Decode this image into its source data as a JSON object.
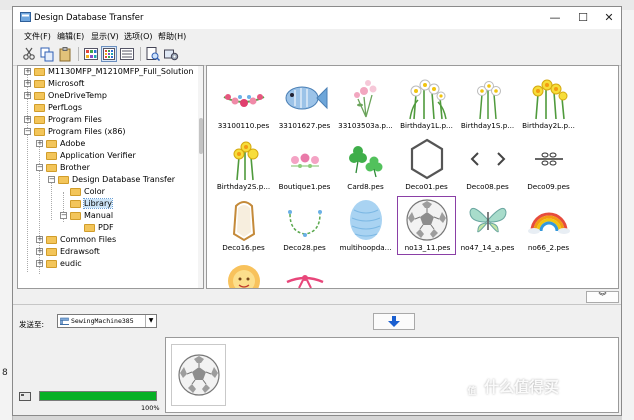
{
  "window": {
    "title": "Design Database Transfer"
  },
  "window_controls": {
    "minimize": "—",
    "maximize": "☐",
    "close": "✕"
  },
  "menu": [
    "文件(F)",
    "编辑(E)",
    "显示(V)",
    "选项(O)",
    "帮助(H)"
  ],
  "tree": {
    "items": [
      {
        "label": "M1130MFP_M1210MFP_Full_Solution",
        "depth": 0,
        "expander": "+"
      },
      {
        "label": "Microsoft",
        "depth": 0,
        "expander": "+"
      },
      {
        "label": "OneDriveTemp",
        "depth": 0,
        "expander": "+"
      },
      {
        "label": "PerfLogs",
        "depth": 0,
        "expander": ""
      },
      {
        "label": "Program Files",
        "depth": 0,
        "expander": "+"
      },
      {
        "label": "Program Files (x86)",
        "depth": 0,
        "expander": "−"
      },
      {
        "label": "Adobe",
        "depth": 1,
        "expander": "+"
      },
      {
        "label": "Application Verifier",
        "depth": 1,
        "expander": ""
      },
      {
        "label": "Brother",
        "depth": 1,
        "expander": "−"
      },
      {
        "label": "Design Database Transfer",
        "depth": 2,
        "expander": "−"
      },
      {
        "label": "Color",
        "depth": 3,
        "expander": ""
      },
      {
        "label": "Library",
        "depth": 3,
        "expander": "",
        "selected": true
      },
      {
        "label": "Manual",
        "depth": 3,
        "expander": "−"
      },
      {
        "label": "PDF",
        "depth": 4,
        "expander": ""
      },
      {
        "label": "Common Files",
        "depth": 1,
        "expander": "+"
      },
      {
        "label": "Edrawsoft",
        "depth": 1,
        "expander": "+"
      },
      {
        "label": "eudic",
        "depth": 1,
        "expander": "+"
      }
    ]
  },
  "gallery": {
    "files": [
      {
        "name": "33100110.pes",
        "icon": "floral-garland-icon"
      },
      {
        "name": "33101627.pes",
        "icon": "blue-fish-icon"
      },
      {
        "name": "33103503a.p...",
        "icon": "flower-bouquet-icon"
      },
      {
        "name": "Birthday1L.p...",
        "icon": "white-daffodils-icon"
      },
      {
        "name": "Birthday1S.p...",
        "icon": "white-daffodils-small-icon"
      },
      {
        "name": "Birthday2L.p...",
        "icon": "yellow-daffodils-icon"
      },
      {
        "name": "Birthday2S.p...",
        "icon": "yellow-daffodils-small-icon"
      },
      {
        "name": "Boutique1.pes",
        "icon": "pink-flowers-icon"
      },
      {
        "name": "Card8.pes",
        "icon": "shamrocks-icon"
      },
      {
        "name": "Deco01.pes",
        "icon": "hexagon-frame-icon"
      },
      {
        "name": "Deco08.pes",
        "icon": "arrow-ornament-icon"
      },
      {
        "name": "Deco09.pes",
        "icon": "dragonfly-ornament-icon"
      },
      {
        "name": "Deco16.pes",
        "icon": "gold-frame-icon"
      },
      {
        "name": "Deco28.pes",
        "icon": "leaf-wreath-icon"
      },
      {
        "name": "multihoopda...",
        "icon": "blue-texture-icon"
      },
      {
        "name": "no13_11.pes",
        "icon": "soccer-ball-icon",
        "selected": true
      },
      {
        "name": "no47_14_a.pes",
        "icon": "butterfly-icon"
      },
      {
        "name": "no66_2.pes",
        "icon": "rainbow-icon"
      },
      {
        "name": "",
        "icon": "sun-face-icon"
      },
      {
        "name": "",
        "icon": "pink-ribbon-icon"
      }
    ]
  },
  "collapse_button": "︾",
  "transfer": {
    "send_to_label": "发送至:",
    "device": "SewingMachine385",
    "transfer_button_icon": "down-arrow-icon"
  },
  "target": {
    "items": [
      {
        "icon": "soccer-ball-icon"
      }
    ]
  },
  "progress": {
    "value": 1.0,
    "label": "100%"
  },
  "background": {
    "left_digit": "8"
  },
  "watermark": {
    "logo_text": "值",
    "text": "什么值得买"
  },
  "colors": {
    "selection_border": "#8a3fa6",
    "progress": "#06b025",
    "transfer_arrow": "#1a5fd0"
  }
}
